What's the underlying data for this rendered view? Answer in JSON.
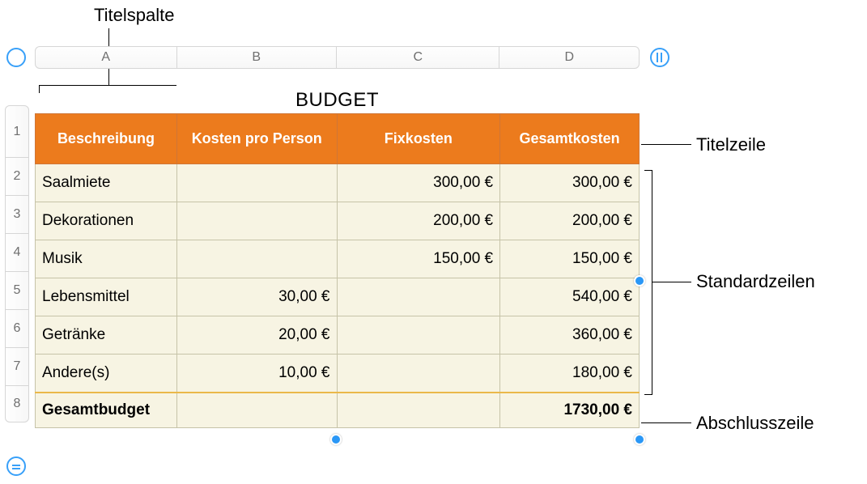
{
  "annotations": {
    "title_column": "Titelspalte",
    "title_row": "Titelzeile",
    "standard_rows": "Standardzeilen",
    "footer_row": "Abschlusszeile"
  },
  "columns": {
    "letters": [
      "A",
      "B",
      "C",
      "D"
    ]
  },
  "row_numbers": [
    "1",
    "2",
    "3",
    "4",
    "5",
    "6",
    "7",
    "8"
  ],
  "table": {
    "title": "BUDGET",
    "headers": {
      "desc": "Beschreibung",
      "per_person": "Kosten pro Person",
      "fixed": "Fixkosten",
      "total": "Gesamtkosten"
    },
    "rows": [
      {
        "desc": "Saalmiete",
        "per_person": "",
        "fixed": "300,00 €",
        "total": "300,00 €"
      },
      {
        "desc": "Dekorationen",
        "per_person": "",
        "fixed": "200,00 €",
        "total": "200,00 €"
      },
      {
        "desc": "Musik",
        "per_person": "",
        "fixed": "150,00 €",
        "total": "150,00 €"
      },
      {
        "desc": "Lebensmittel",
        "per_person": "30,00 €",
        "fixed": "",
        "total": "540,00 €"
      },
      {
        "desc": "Getränke",
        "per_person": "20,00 €",
        "fixed": "",
        "total": "360,00 €"
      },
      {
        "desc": "Andere(s)",
        "per_person": "10,00 €",
        "fixed": "",
        "total": "180,00 €"
      }
    ],
    "footer": {
      "label": "Gesamtbudget",
      "total": "1730,00 €"
    }
  }
}
